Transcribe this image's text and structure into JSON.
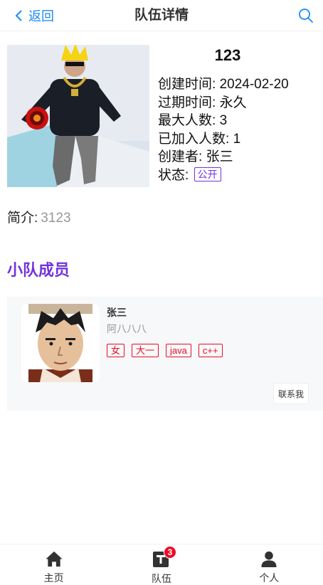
{
  "navbar": {
    "back_label": "返回",
    "title": "队伍详情"
  },
  "team": {
    "name": "123",
    "create_time_label": "创建时间: ",
    "create_time": "2024-02-20",
    "expire_time_label": "过期时间: ",
    "expire_time": "永久",
    "max_num_label": "最大人数: ",
    "max_num": "3",
    "joined_num_label": "已加入人数: ",
    "joined_num": "1",
    "creator_label": "创建者: ",
    "creator": "张三",
    "status_label": "状态: ",
    "status": "公开",
    "intro_label": "简介:",
    "intro": "3123"
  },
  "members_section": {
    "title": "小队成员",
    "members": [
      {
        "name": "张三",
        "desc": "阿八八八",
        "tags": [
          "女",
          "大一",
          "java",
          "c++"
        ],
        "contact_label": "联系我"
      }
    ]
  },
  "tabbar": {
    "items": [
      {
        "label": "主页",
        "icon": "home-icon"
      },
      {
        "label": "队伍",
        "icon": "team-icon",
        "badge": "3"
      },
      {
        "label": "个人",
        "icon": "user-icon"
      }
    ]
  },
  "colors": {
    "link": "#1989fa",
    "accent": "#7232dd",
    "tag": "#ee0a24",
    "badge": "#ee0a24"
  }
}
